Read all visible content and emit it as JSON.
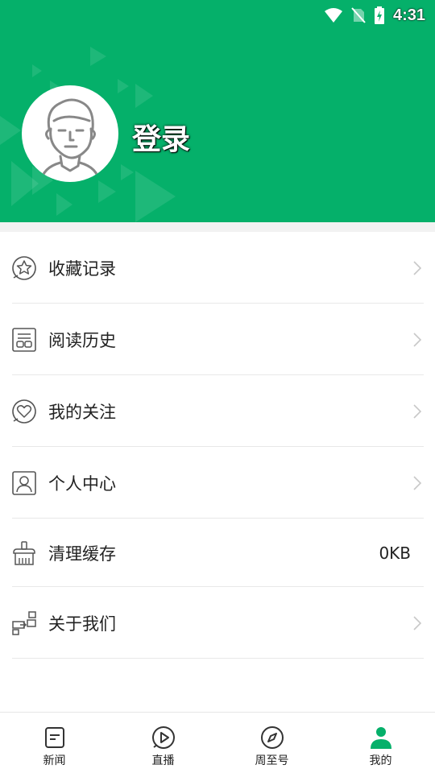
{
  "status_bar": {
    "time": "4:31",
    "icons": [
      "wifi-icon",
      "no-sim-icon",
      "battery-charging-icon"
    ]
  },
  "header": {
    "login_label": "登录",
    "avatar_icon": "user-avatar-icon",
    "background_color": "#05b06a"
  },
  "menu": {
    "items": [
      {
        "label": "收藏记录",
        "icon": "star-icon"
      },
      {
        "label": "阅读历史",
        "icon": "history-icon"
      },
      {
        "label": "我的关注",
        "icon": "heart-icon"
      },
      {
        "label": "个人中心",
        "icon": "person-icon"
      },
      {
        "label": "清理缓存",
        "icon": "broom-icon",
        "value": "0KB"
      },
      {
        "label": "关于我们",
        "icon": "about-icon"
      }
    ]
  },
  "tabbar": {
    "active_color": "#05b06a",
    "tabs": [
      {
        "label": "新闻",
        "icon": "news-icon",
        "active": false
      },
      {
        "label": "直播",
        "icon": "play-icon",
        "active": false
      },
      {
        "label": "周至号",
        "icon": "compass-icon",
        "active": false
      },
      {
        "label": "我的",
        "icon": "profile-icon",
        "active": true
      }
    ]
  }
}
